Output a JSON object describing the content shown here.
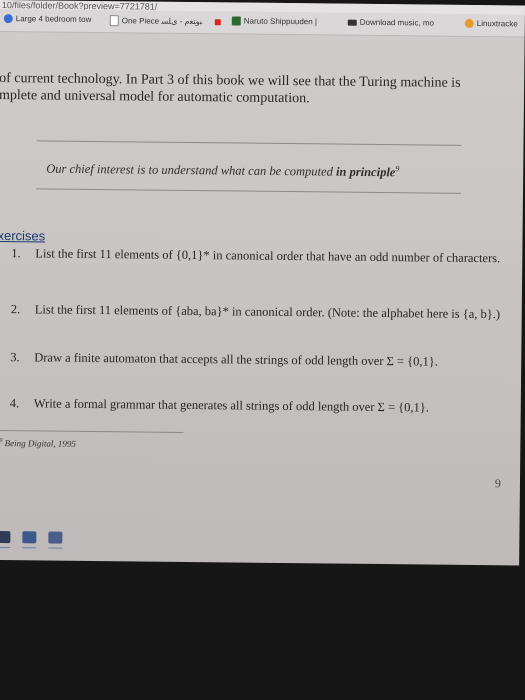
{
  "browser": {
    "url": "10/files/folder/Book?preview=7721781/",
    "bookmarks": [
      {
        "label": "Large 4 bedroom tow",
        "icon": "blue-circle-icon",
        "color": "#3b6fd6"
      },
      {
        "label": "One Piece ﺒﻭﺘﻐﻡ - ﻯﻠﺴ",
        "icon": "document-icon",
        "color": "#888888"
      },
      {
        "label": "Naruto Shippuuden |",
        "icon": "image-icon",
        "color": "#2d6a2d"
      },
      {
        "label": "Download music, mo",
        "icon": "download-icon",
        "color": "#333333"
      },
      {
        "label": "Linuxtracke",
        "icon": "orange-circle-icon",
        "color": "#e89a2b"
      }
    ]
  },
  "book": {
    "para_line1": "of current technology. In Part 3 of this book we will see that the Turing machine is",
    "para_line2": "mplete and universal model for automatic computation.",
    "quote_main": "Our chief interest is to understand what can be computed ",
    "quote_em": "in principle",
    "quote_sup": "9",
    "exercises_heading": "xercises",
    "exercises": [
      {
        "num": "1.",
        "text": "List the first 11 elements of {0,1}* in canonical order that have an odd number of characters."
      },
      {
        "num": "2.",
        "text": "List the first 11 elements of {aba, ba}* in canonical order. (Note: the alphabet here is {a, b}.)"
      },
      {
        "num": "3.",
        "text": "Draw a finite automaton that accepts all the strings of odd length over Σ = {0,1}."
      },
      {
        "num": "4.",
        "text": "Write a formal grammar that generates all strings of odd length over Σ = {0,1}."
      }
    ],
    "footnote_num": "9",
    "footnote_text": "Being Digital, 1995",
    "page_number": "9"
  },
  "taskbar": {
    "colors": [
      "#2f3a55",
      "#3b5a8a",
      "#4b5e8a"
    ]
  }
}
